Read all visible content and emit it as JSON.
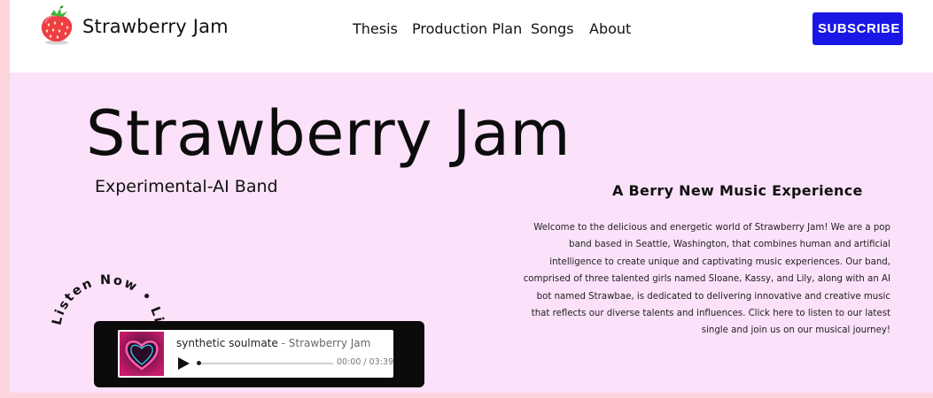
{
  "header": {
    "brand": "Strawberry Jam",
    "nav": [
      "Thesis",
      "Production Plan",
      "Songs",
      "About"
    ],
    "subscribe_label": "SUBSCRIBE"
  },
  "hero": {
    "title": "Strawberry Jam",
    "subtitle": "Experimental-AI Band",
    "heading": "A Berry New Music Experience",
    "description": "Welcome to the delicious and energetic world of Strawberry Jam! We are a pop band based in Seattle, Washington, that combines human and artificial intelligence to create unique and captivating music experiences. Our band, comprised of three talented girls named Sloane, Kassy, and Lily, along with an AI bot named Strawbae, is dedicated to delivering innovative and creative music that reflects our diverse talents and influences. Click here to listen to our latest single and join us on our musical journey!",
    "ring_text": "Listen Now • Listen Now • "
  },
  "player": {
    "track": "synthetic soulmate",
    "separator": " - ",
    "artist": "Strawberry Jam",
    "time": "00:00 / 03:39",
    "progress": 0
  },
  "colors": {
    "page_bg": "#fbd4dc",
    "hero_bg": "#fbe1f9",
    "subscribe_bg": "#1a17e6"
  }
}
